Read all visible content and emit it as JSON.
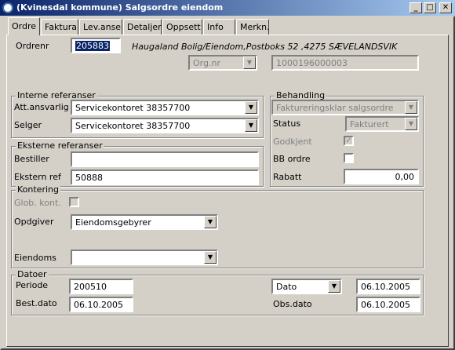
{
  "window": {
    "title": "(Kvinesdal kommune) Salgsordre eiendom"
  },
  "tabs": [
    {
      "label": "Ordre"
    },
    {
      "label": "Faktura"
    },
    {
      "label": "Lev.anse"
    },
    {
      "label": "Detaljer"
    },
    {
      "label": "Oppsett"
    },
    {
      "label": "Info"
    },
    {
      "label": "Merkn."
    }
  ],
  "order": {
    "ordrenr_label": "Ordrenr",
    "ordrenr_value": "205883",
    "customer_address": "Haugaland Bolig/Eiendom,Postboks 52 ,4275 SÆVELANDSVIK",
    "orgnr_select": "Org.nr",
    "orgnr_value": "1000196000003"
  },
  "interne": {
    "title": "Interne referanser",
    "att_label": "Att.ansvarlig",
    "att_value": "Servicekontoret 38357700",
    "selger_label": "Selger",
    "selger_value": "Servicekontoret 38357700"
  },
  "eksterne": {
    "title": "Eksterne referanser",
    "bestiller_label": "Bestiller",
    "bestiller_value": "",
    "ekstern_label": "Ekstern ref",
    "ekstern_value": "50888"
  },
  "behandling": {
    "title": "Behandling",
    "status_select": "Faktureringsklar salgsordre",
    "status_label": "Status",
    "status_value": "Fakturert",
    "godkjent_label": "Godkjent",
    "godkjent_checked": "✓",
    "bb_label": "BB ordre",
    "rabatt_label": "Rabatt",
    "rabatt_value": "0,00"
  },
  "kontering": {
    "title": "Kontering",
    "glob_label": "Glob. kont.",
    "opdgiver_label": "Opdgiver",
    "opdgiver_value": "Eiendomsgebyrer",
    "eiendoms_label": "Eiendoms",
    "eiendoms_value": ""
  },
  "datoer": {
    "title": "Datoer",
    "periode_label": "Periode",
    "periode_value": "200510",
    "bestdato_label": "Best.dato",
    "bestdato_value": "06.10.2005",
    "dato_select": "Dato",
    "dato_value": "06.10.2005",
    "obsdato_label": "Obs.dato",
    "obsdato_value": "06.10.2005"
  },
  "icons": {
    "dropdown": "▼",
    "minimize": "_",
    "maximize": "□",
    "close": "✕"
  }
}
